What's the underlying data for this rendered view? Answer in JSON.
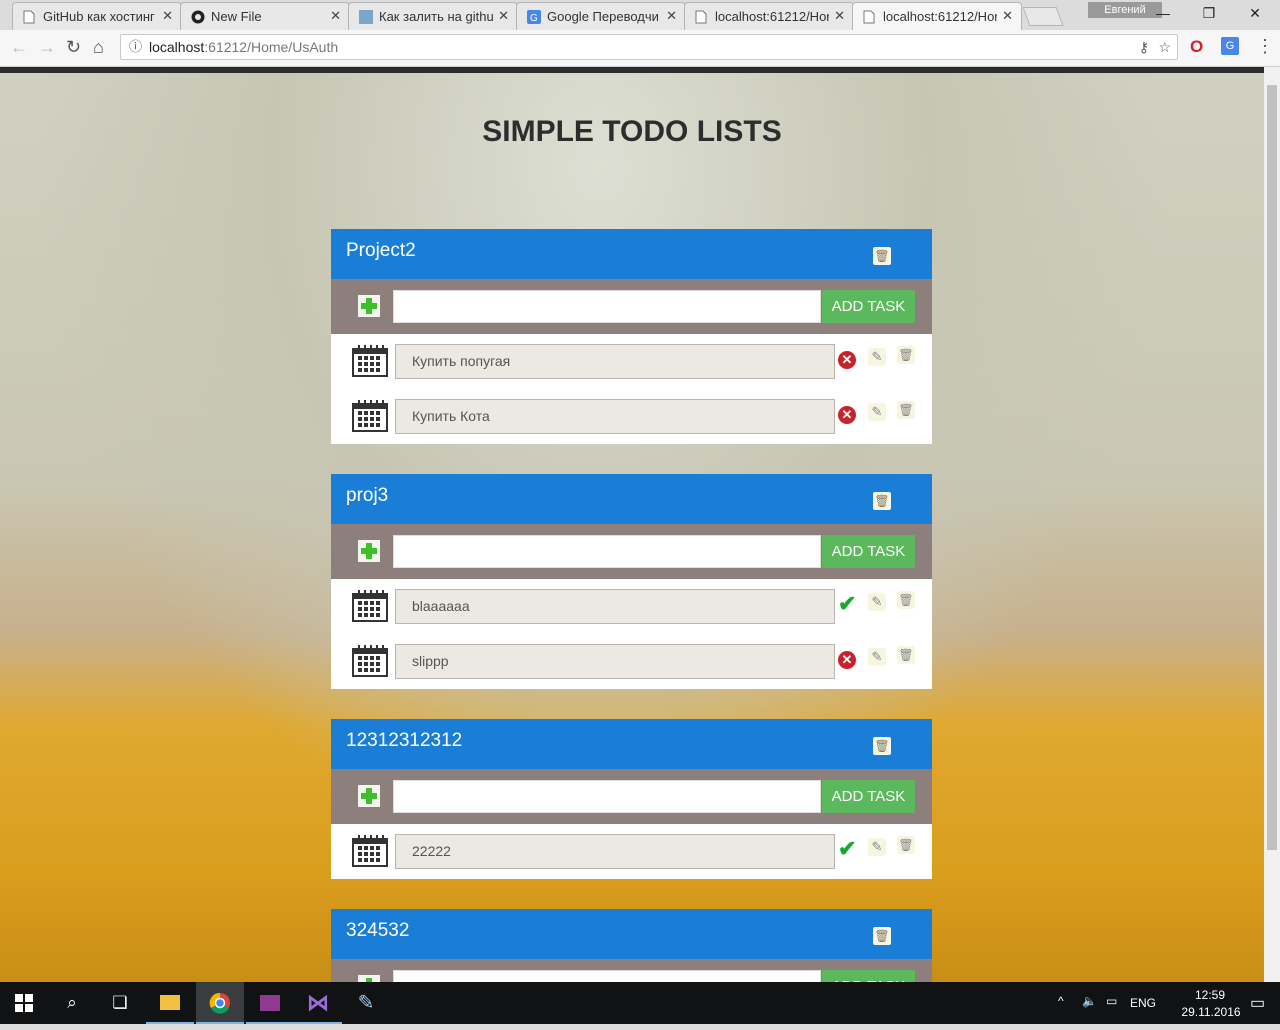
{
  "browser": {
    "tabs": [
      {
        "title": "GitHub как хостинг",
        "icon": "page-icon"
      },
      {
        "title": "New File",
        "icon": "github-icon"
      },
      {
        "title": "Как залить на githu",
        "icon": "ru-site-icon"
      },
      {
        "title": "Google Переводчи",
        "icon": "google-translate-icon"
      },
      {
        "title": "localhost:61212/Hor",
        "icon": "page-icon"
      },
      {
        "title": "localhost:61212/Hor",
        "icon": "page-icon"
      }
    ],
    "active_tab": 5,
    "profile_name": "Евгений",
    "url_host": "localhost",
    "url_rest": ":61212/Home/UsAuth"
  },
  "page": {
    "title": "SIMPLE TODO LISTS",
    "add_task_label": "ADD TASK",
    "projects": [
      {
        "name": "Project2",
        "tasks": [
          {
            "text": "Купить попугая",
            "done": false
          },
          {
            "text": "Купить Кота",
            "done": false
          }
        ]
      },
      {
        "name": "proj3",
        "tasks": [
          {
            "text": "blaaaaaa",
            "done": true
          },
          {
            "text": "slippp",
            "done": false
          }
        ]
      },
      {
        "name": "12312312312",
        "tasks": [
          {
            "text": "22222",
            "done": true
          }
        ]
      },
      {
        "name": "324532",
        "tasks": []
      }
    ]
  },
  "taskbar": {
    "language": "ENG",
    "time": "12:59",
    "date": "29.11.2016"
  },
  "colors": {
    "header_blue": "#1a7ed7",
    "add_bar": "#8c7f7c",
    "add_button": "#5cb85c"
  }
}
